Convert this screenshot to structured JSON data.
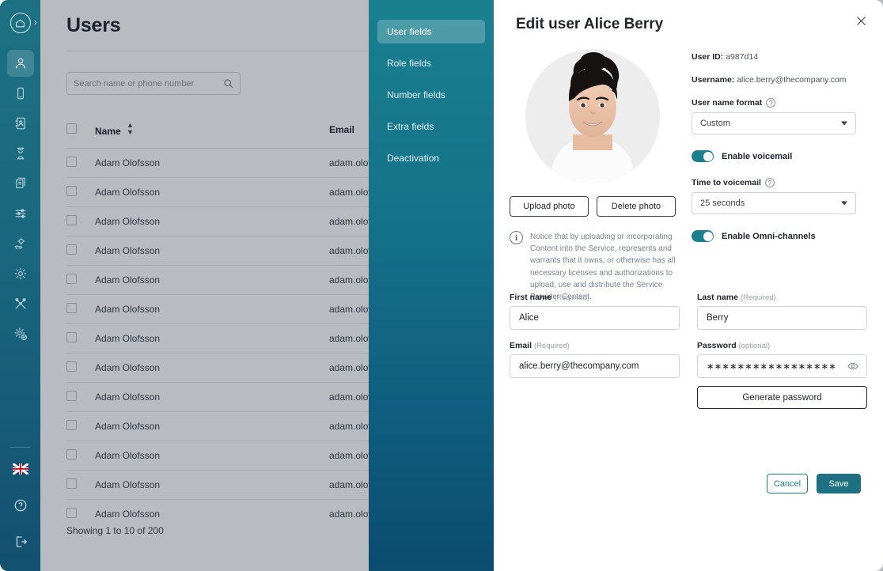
{
  "rail": {
    "home_icon": "home-icon",
    "expand_icon": "chevron-right-icon",
    "items": [
      {
        "name": "users",
        "icon": "user-icon",
        "active": true
      },
      {
        "name": "devices",
        "icon": "mobile-phone-icon",
        "active": false
      },
      {
        "name": "contacts",
        "icon": "address-book-icon",
        "active": false
      },
      {
        "name": "queues",
        "icon": "call-queue-icon",
        "active": false
      },
      {
        "name": "billing",
        "icon": "invoice-icon",
        "active": false
      },
      {
        "name": "settings-list",
        "icon": "sliders-icon",
        "active": false
      },
      {
        "name": "support",
        "icon": "hand-gear-icon",
        "active": false
      },
      {
        "name": "configuration",
        "icon": "gear-icon",
        "active": false
      },
      {
        "name": "tools",
        "icon": "tools-icon",
        "active": false
      },
      {
        "name": "admin",
        "icon": "gear-check-icon",
        "active": false
      }
    ],
    "bottom_items": [
      {
        "name": "language",
        "icon": "uk-flag-icon",
        "label": "English"
      },
      {
        "name": "help",
        "icon": "question-circle-icon",
        "label": "Help"
      },
      {
        "name": "logout",
        "icon": "logout-icon",
        "label": "Log out"
      }
    ]
  },
  "page": {
    "title": "Users",
    "search": {
      "placeholder": "Search name or phone number",
      "value": "",
      "icon": "search-icon"
    },
    "table": {
      "columns": [
        "",
        "Name",
        "Email"
      ],
      "sort_column": "Name",
      "sort_icon": "sort-arrows-icon",
      "rows": [
        {
          "name": "Adam Olofsson",
          "email": "adam.olofsson@thecompany.com"
        },
        {
          "name": "Adam Olofsson",
          "email": "adam.olofsson@thecompany.com"
        },
        {
          "name": "Adam Olofsson",
          "email": "adam.olofsson@thecompany.com"
        },
        {
          "name": "Adam Olofsson",
          "email": "adam.olofsson@thecompany.com"
        },
        {
          "name": "Adam Olofsson",
          "email": "adam.olofsson@thecompany.com"
        },
        {
          "name": "Adam Olofsson",
          "email": "adam.olofsson@thecompany.com"
        },
        {
          "name": "Adam Olofsson",
          "email": "adam.olofsson@thecompany.com"
        },
        {
          "name": "Adam Olofsson",
          "email": "adam.olofsson@thecompany.com"
        },
        {
          "name": "Adam Olofsson",
          "email": "adam.olofsson@thecompany.com"
        },
        {
          "name": "Adam Olofsson",
          "email": "adam.olofsson@thecompany.com"
        },
        {
          "name": "Adam Olofsson",
          "email": "adam.olofsson@thecompany.com"
        },
        {
          "name": "Adam Olofsson",
          "email": "adam.olofsson@thecompany.com"
        },
        {
          "name": "Adam Olofsson",
          "email": "adam.olofsson@thecompany.com"
        }
      ]
    },
    "showing": "Showing 1 to 10 of 200"
  },
  "modal": {
    "title": "Edit user Alice Berry",
    "close_icon": "close-icon",
    "tabs": [
      {
        "label": "User fields",
        "active": true
      },
      {
        "label": "Role fields",
        "active": false
      },
      {
        "label": "Number fields",
        "active": false
      },
      {
        "label": "Extra fields",
        "active": false
      },
      {
        "label": "Deactivation",
        "active": false
      }
    ],
    "avatar": {
      "name": "user-avatar-photo",
      "alt": "Photo of Alice Berry"
    },
    "photo_buttons": {
      "upload": "Upload photo",
      "delete": "Delete photo"
    },
    "notice": {
      "icon": "info-icon",
      "text": "Notice that by uploading or incorporating Content into the Service, represents and warrants that it owns, or otherwise has all necessary licenses and authorizations to upload, use and distribute the Service Provider Content."
    },
    "meta": {
      "user_id_label": "User ID:",
      "user_id_value": "a987d14",
      "username_label": "Username:",
      "username_value": "alice.berry@thecompany.com"
    },
    "username_format": {
      "label": "User name format",
      "help_icon": "help-circle-icon",
      "value": "Custom",
      "caret_icon": "chevron-down-icon"
    },
    "enable_voicemail": {
      "label": "Enable voicemail",
      "on": true
    },
    "time_to_voicemail": {
      "label": "Time to voicemail",
      "help_icon": "help-circle-icon",
      "value": "25 seconds",
      "caret_icon": "chevron-down-icon"
    },
    "enable_omni": {
      "label": "Enable Omni-channels",
      "on": true
    },
    "fields": {
      "first_name": {
        "label": "First name",
        "req": "(Required)",
        "value": "Alice"
      },
      "last_name": {
        "label": "Last name",
        "req": "(Required)",
        "value": "Berry"
      },
      "email": {
        "label": "Email",
        "req": "(Required)",
        "value": "alice.berry@thecompany.com"
      },
      "password": {
        "label": "Password",
        "req": "(optional)",
        "value": "∗∗∗∗∗∗∗∗∗∗∗∗∗∗∗∗∗",
        "reveal_icon": "eye-icon"
      },
      "generate_password": "Generate password"
    },
    "footer": {
      "cancel": "Cancel",
      "save": "Save"
    }
  },
  "colors": {
    "teal": "#1a808f",
    "rail": "#1d7183",
    "deep_blue": "#0b4c6f",
    "text": "#22252b",
    "muted": "#7b8189"
  }
}
